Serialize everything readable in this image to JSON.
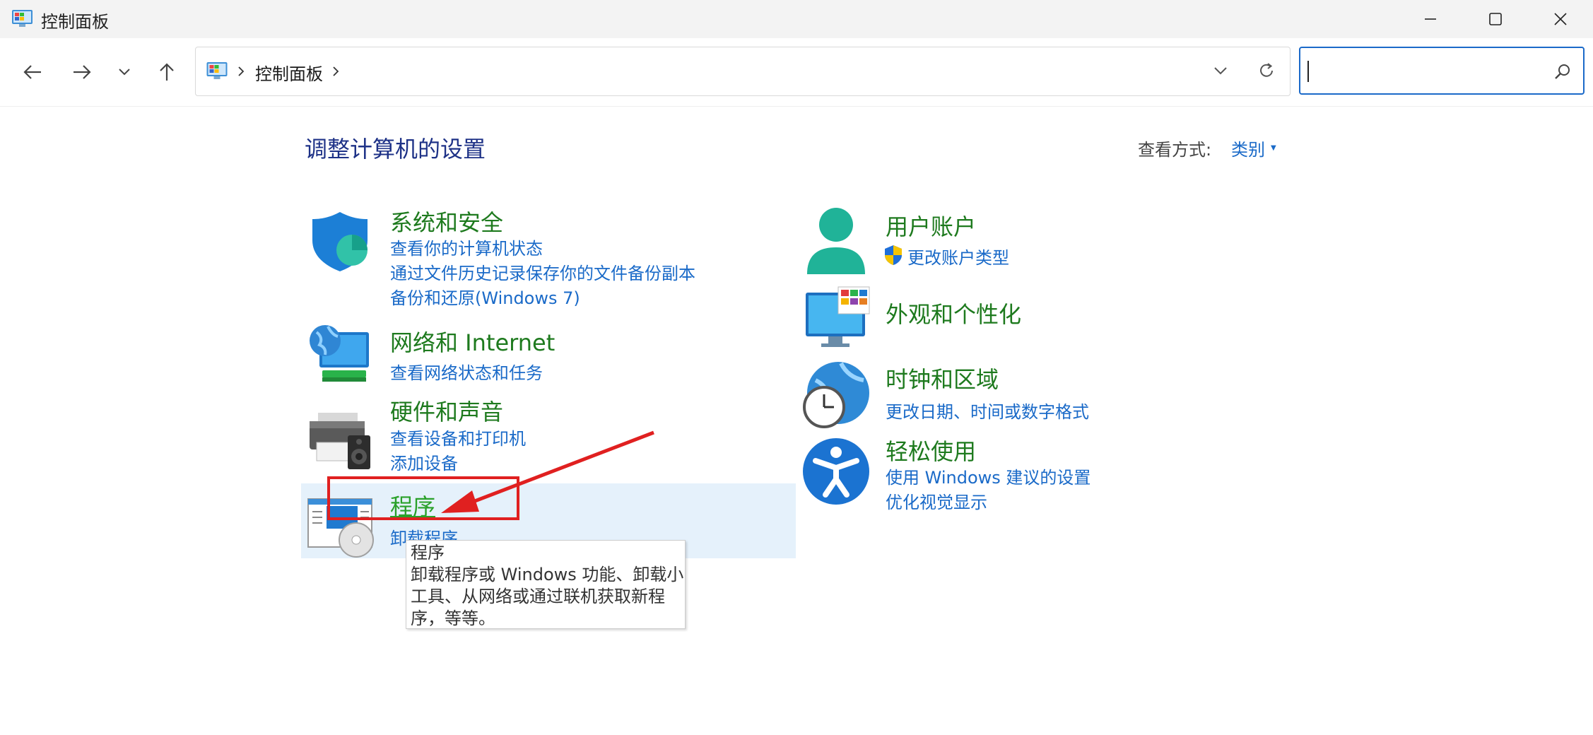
{
  "window": {
    "title": "控制面板",
    "icon": "control-panel-icon",
    "controls": [
      "minimize-icon",
      "maximize-icon",
      "close-icon"
    ]
  },
  "nav": {
    "buttons": [
      "back-arrow-icon",
      "forward-arrow-icon",
      "recent-locations-chevron-icon",
      "up-arrow-icon"
    ],
    "breadcrumb": [
      "控制面板"
    ],
    "search_value": ""
  },
  "main": {
    "heading": "调整计算机的设置",
    "view_by_label": "查看方式:",
    "view_by_value": "类别"
  },
  "categories_left": [
    {
      "title": "系统和安全",
      "icon": "shield-icon",
      "links": [
        "查看你的计算机状态",
        "通过文件历史记录保存你的文件备份副本",
        "备份和还原(Windows 7)"
      ]
    },
    {
      "title": "网络和 Internet",
      "icon": "network-globe-monitor-icon",
      "links": [
        "查看网络状态和任务"
      ]
    },
    {
      "title": "硬件和声音",
      "icon": "printer-speaker-icon",
      "links": [
        "查看设备和打印机",
        "添加设备"
      ]
    },
    {
      "title": "程序",
      "icon": "programs-icon",
      "links": [
        "卸载程序"
      ]
    }
  ],
  "categories_right": [
    {
      "title": "用户账户",
      "icon": "user-icon",
      "links": [
        "更改账户类型"
      ],
      "link_icon": "uac-shield-icon"
    },
    {
      "title": "外观和个性化",
      "icon": "appearance-monitor-icon",
      "links": []
    },
    {
      "title": "时钟和区域",
      "icon": "clock-globe-icon",
      "links": [
        "更改日期、时间或数字格式"
      ]
    },
    {
      "title": "轻松使用",
      "icon": "accessibility-icon",
      "links": [
        "使用 Windows 建议的设置",
        "优化视觉显示"
      ]
    }
  ],
  "tooltip": {
    "title": "程序",
    "description": "卸载程序或 Windows 功能、卸载小工具、从网络或通过联机获取新程序，等等。"
  },
  "annotation": {
    "highlight_color": "#e02020"
  }
}
